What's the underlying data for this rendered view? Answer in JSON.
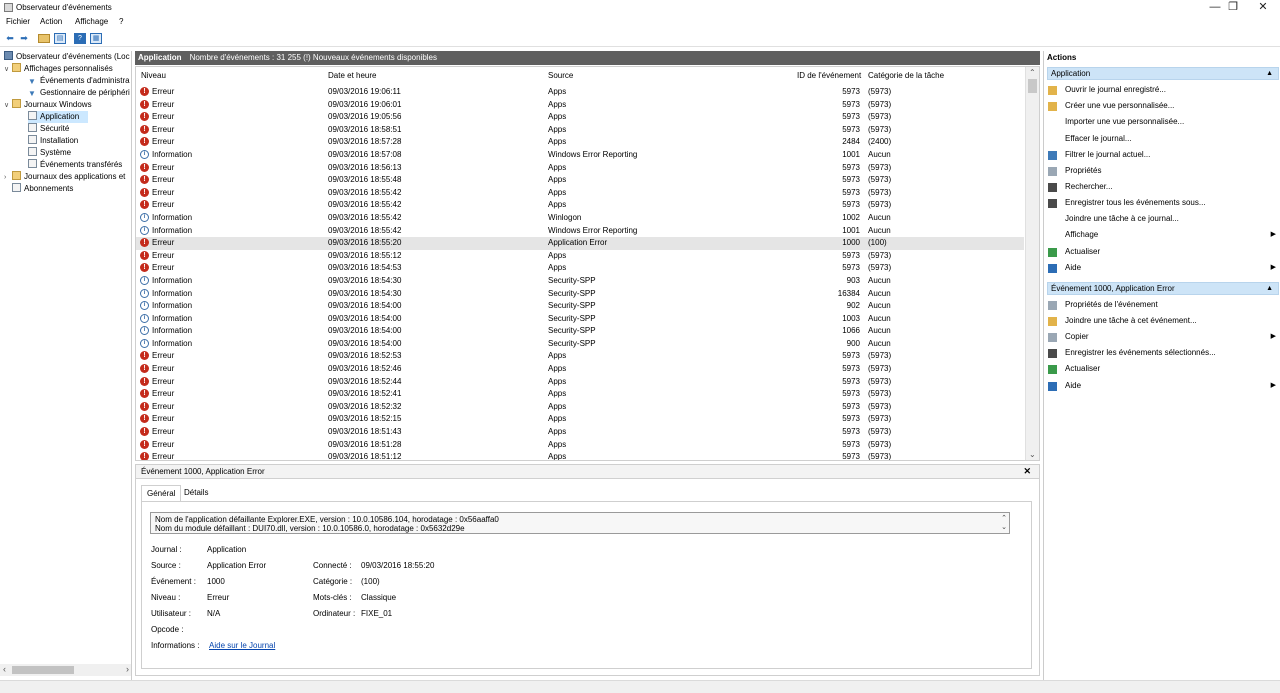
{
  "window": {
    "title": "Observateur d'événements",
    "minimize": "—",
    "maximize": "❐",
    "close": "✕"
  },
  "menu": [
    "Fichier",
    "Action",
    "Affichage",
    "?"
  ],
  "tree": {
    "root": "Observateur d'événements (Loc",
    "custom_views": "Affichages personnalisés",
    "admin_events": "Événements d'administra",
    "device_manager": "Gestionnaire de périphéri",
    "windows_logs": "Journaux Windows",
    "application": "Application",
    "security": "Sécurité",
    "setup": "Installation",
    "system": "Système",
    "forwarded": "Événements transférés",
    "app_logs": "Journaux des applications et",
    "subscriptions": "Abonnements"
  },
  "list": {
    "header_name": "Application",
    "header_info": "Nombre d'événements : 31 255 (!) Nouveaux événements disponibles",
    "columns": {
      "level": "Niveau",
      "date": "Date et heure",
      "source": "Source",
      "id": "ID de l'événement",
      "category": "Catégorie de la tâche"
    },
    "rows": [
      {
        "level": "Erreur",
        "type": "err",
        "date": "09/03/2016 19:06:11",
        "source": "Apps",
        "id": "5973",
        "category": "(5973)"
      },
      {
        "level": "Erreur",
        "type": "err",
        "date": "09/03/2016 19:06:01",
        "source": "Apps",
        "id": "5973",
        "category": "(5973)"
      },
      {
        "level": "Erreur",
        "type": "err",
        "date": "09/03/2016 19:05:56",
        "source": "Apps",
        "id": "5973",
        "category": "(5973)"
      },
      {
        "level": "Erreur",
        "type": "err",
        "date": "09/03/2016 18:58:51",
        "source": "Apps",
        "id": "5973",
        "category": "(5973)"
      },
      {
        "level": "Erreur",
        "type": "err",
        "date": "09/03/2016 18:57:28",
        "source": "Apps",
        "id": "2484",
        "category": "(2400)"
      },
      {
        "level": "Information",
        "type": "info",
        "date": "09/03/2016 18:57:08",
        "source": "Windows Error Reporting",
        "id": "1001",
        "category": "Aucun"
      },
      {
        "level": "Erreur",
        "type": "err",
        "date": "09/03/2016 18:56:13",
        "source": "Apps",
        "id": "5973",
        "category": "(5973)"
      },
      {
        "level": "Erreur",
        "type": "err",
        "date": "09/03/2016 18:55:48",
        "source": "Apps",
        "id": "5973",
        "category": "(5973)"
      },
      {
        "level": "Erreur",
        "type": "err",
        "date": "09/03/2016 18:55:42",
        "source": "Apps",
        "id": "5973",
        "category": "(5973)"
      },
      {
        "level": "Erreur",
        "type": "err",
        "date": "09/03/2016 18:55:42",
        "source": "Apps",
        "id": "5973",
        "category": "(5973)"
      },
      {
        "level": "Information",
        "type": "info",
        "date": "09/03/2016 18:55:42",
        "source": "Winlogon",
        "id": "1002",
        "category": "Aucun"
      },
      {
        "level": "Information",
        "type": "info",
        "date": "09/03/2016 18:55:42",
        "source": "Windows Error Reporting",
        "id": "1001",
        "category": "Aucun"
      },
      {
        "level": "Erreur",
        "type": "err",
        "date": "09/03/2016 18:55:20",
        "source": "Application Error",
        "id": "1000",
        "category": "(100)",
        "selected": true
      },
      {
        "level": "Erreur",
        "type": "err",
        "date": "09/03/2016 18:55:12",
        "source": "Apps",
        "id": "5973",
        "category": "(5973)"
      },
      {
        "level": "Erreur",
        "type": "err",
        "date": "09/03/2016 18:54:53",
        "source": "Apps",
        "id": "5973",
        "category": "(5973)"
      },
      {
        "level": "Information",
        "type": "info",
        "date": "09/03/2016 18:54:30",
        "source": "Security-SPP",
        "id": "903",
        "category": "Aucun"
      },
      {
        "level": "Information",
        "type": "info",
        "date": "09/03/2016 18:54:30",
        "source": "Security-SPP",
        "id": "16384",
        "category": "Aucun"
      },
      {
        "level": "Information",
        "type": "info",
        "date": "09/03/2016 18:54:00",
        "source": "Security-SPP",
        "id": "902",
        "category": "Aucun"
      },
      {
        "level": "Information",
        "type": "info",
        "date": "09/03/2016 18:54:00",
        "source": "Security-SPP",
        "id": "1003",
        "category": "Aucun"
      },
      {
        "level": "Information",
        "type": "info",
        "date": "09/03/2016 18:54:00",
        "source": "Security-SPP",
        "id": "1066",
        "category": "Aucun"
      },
      {
        "level": "Information",
        "type": "info",
        "date": "09/03/2016 18:54:00",
        "source": "Security-SPP",
        "id": "900",
        "category": "Aucun"
      },
      {
        "level": "Erreur",
        "type": "err",
        "date": "09/03/2016 18:52:53",
        "source": "Apps",
        "id": "5973",
        "category": "(5973)"
      },
      {
        "level": "Erreur",
        "type": "err",
        "date": "09/03/2016 18:52:46",
        "source": "Apps",
        "id": "5973",
        "category": "(5973)"
      },
      {
        "level": "Erreur",
        "type": "err",
        "date": "09/03/2016 18:52:44",
        "source": "Apps",
        "id": "5973",
        "category": "(5973)"
      },
      {
        "level": "Erreur",
        "type": "err",
        "date": "09/03/2016 18:52:41",
        "source": "Apps",
        "id": "5973",
        "category": "(5973)"
      },
      {
        "level": "Erreur",
        "type": "err",
        "date": "09/03/2016 18:52:32",
        "source": "Apps",
        "id": "5973",
        "category": "(5973)"
      },
      {
        "level": "Erreur",
        "type": "err",
        "date": "09/03/2016 18:52:15",
        "source": "Apps",
        "id": "5973",
        "category": "(5973)"
      },
      {
        "level": "Erreur",
        "type": "err",
        "date": "09/03/2016 18:51:43",
        "source": "Apps",
        "id": "5973",
        "category": "(5973)"
      },
      {
        "level": "Erreur",
        "type": "err",
        "date": "09/03/2016 18:51:28",
        "source": "Apps",
        "id": "5973",
        "category": "(5973)"
      },
      {
        "level": "Erreur",
        "type": "err",
        "date": "09/03/2016 18:51:12",
        "source": "Apps",
        "id": "5973",
        "category": "(5973)"
      }
    ]
  },
  "detail": {
    "title": "Événement 1000, Application Error",
    "tab_general": "Général",
    "tab_details": "Détails",
    "message_line1": "Nom de l'application défaillante Explorer.EXE, version : 10.0.10586.104, horodatage : 0x56aaffa0",
    "message_line2": "Nom du module défaillant : DUI70.dll, version : 10.0.10586.0, horodatage : 0x5632d29e",
    "labels": {
      "journal": "Journal :",
      "source": "Source :",
      "event": "Événement :",
      "level": "Niveau :",
      "user": "Utilisateur :",
      "opcode": "Opcode :",
      "info": "Informations :",
      "logged": "Connecté :",
      "category": "Catégorie :",
      "keywords": "Mots-clés :",
      "computer": "Ordinateur :"
    },
    "values": {
      "journal": "Application",
      "source": "Application Error",
      "event": "1000",
      "level": "Erreur",
      "user": "N/A",
      "logged": "09/03/2016 18:55:20",
      "category": "(100)",
      "keywords": "Classique",
      "computer": "FIXE_01",
      "info_link": "Aide sur le Journal"
    }
  },
  "actions": {
    "heading": "Actions",
    "section1": "Application",
    "items1": [
      "Ouvrir le journal enregistré...",
      "Créer une vue personnalisée...",
      "Importer une vue personnalisée...",
      "Effacer le journal...",
      "Filtrer le journal actuel...",
      "Propriétés",
      "Rechercher...",
      "Enregistrer tous les événements sous...",
      "Joindre une tâche à ce journal...",
      "Affichage",
      "Actualiser",
      "Aide"
    ],
    "section2": "Événement 1000, Application Error",
    "items2": [
      "Propriétés de l'événement",
      "Joindre une tâche à cet événement...",
      "Copier",
      "Enregistrer les événements sélectionnés...",
      "Actualiser",
      "Aide"
    ]
  },
  "colors": {
    "error": "#c42b1c",
    "info": "#3d6fa8",
    "section": "#cde4f7",
    "header_bar": "#5f5f5f"
  }
}
